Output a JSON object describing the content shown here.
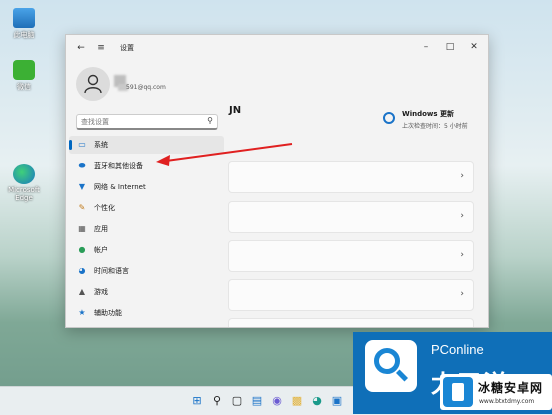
{
  "desktop": {
    "icons": [
      {
        "label": "此电脑",
        "icon": "computer-icon"
      },
      {
        "label": "微信",
        "icon": "wechat-icon"
      },
      {
        "label": "Microsoft Edge",
        "icon": "edge-icon"
      }
    ]
  },
  "window": {
    "title": "设置",
    "back_icon": "back-arrow-icon",
    "menu_icon": "hamburger-icon",
    "account": {
      "email": "591@qq.com",
      "heading": "JN"
    },
    "search": {
      "placeholder": "查找设置",
      "value": ""
    },
    "nav": [
      {
        "label": "系统",
        "icon": "system-icon",
        "active": true
      },
      {
        "label": "蓝牙和其他设备",
        "icon": "bluetooth-icon",
        "active": false
      },
      {
        "label": "网络 & Internet",
        "icon": "wifi-icon",
        "active": false
      },
      {
        "label": "个性化",
        "icon": "brush-icon",
        "active": false
      },
      {
        "label": "应用",
        "icon": "apps-icon",
        "active": false
      },
      {
        "label": "帐户",
        "icon": "account-icon",
        "active": false
      },
      {
        "label": "时间和语言",
        "icon": "globe-icon",
        "active": false
      },
      {
        "label": "游戏",
        "icon": "gamepad-icon",
        "active": false
      },
      {
        "label": "辅助功能",
        "icon": "accessibility-icon",
        "active": false
      }
    ],
    "update": {
      "title": "Windows 更新",
      "subtitle": "上次检查时间：5 小时前"
    }
  },
  "watermark": {
    "brand": "PConline",
    "brand_cn": "太平洋",
    "badge_title": "冰糖安卓网",
    "badge_sub": "www.btxtdmy.com"
  },
  "colors": {
    "accent": "#0067c0",
    "arrow": "#e02020",
    "watermark_blue": "#0f6fb8"
  }
}
